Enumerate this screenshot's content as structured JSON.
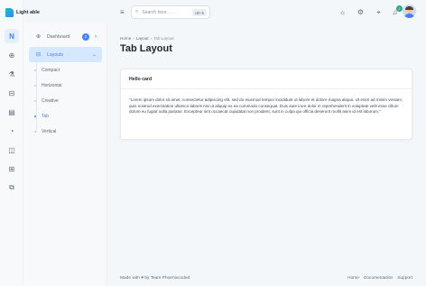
{
  "brand": {
    "name": "Light able"
  },
  "rail": {
    "items": [
      {
        "icon": "N",
        "name": "rail-item-home",
        "active": true
      },
      {
        "icon": "⊕",
        "name": "rail-item-dashboard"
      },
      {
        "icon": "⚗",
        "name": "rail-item-widgets"
      },
      {
        "icon": "⊟",
        "name": "rail-item-layouts"
      },
      {
        "icon": "▤",
        "name": "rail-item-components"
      },
      {
        "icon": "◔",
        "name": "rail-item-charts"
      },
      {
        "icon": "◫",
        "name": "rail-item-forms"
      },
      {
        "icon": "⊞",
        "name": "rail-item-tables"
      },
      {
        "icon": "⧉",
        "name": "rail-item-pages"
      }
    ]
  },
  "sidebar": {
    "dashboard": {
      "label": "Dashboard",
      "icon": "⊕",
      "badge": "2",
      "chevron": "›"
    },
    "layouts": {
      "label": "Layouts",
      "icon": "⊟",
      "chevron": "⌄"
    },
    "subitems": [
      {
        "label": "Compact"
      },
      {
        "label": "Horizontal"
      },
      {
        "label": "Creative"
      },
      {
        "label": "Tab",
        "active": true
      },
      {
        "label": "Vertical"
      }
    ]
  },
  "topbar": {
    "menu_icon": "≡",
    "search_placeholder": "Search here . . .",
    "search_icon": "⌕",
    "shortcut": "ctrl+k",
    "icons": {
      "sun": "☼",
      "settings": "⚙",
      "target": "⌖",
      "bell": "♫"
    },
    "notification_count": "2"
  },
  "breadcrumb": {
    "home": "Home",
    "sep": "›",
    "parent": "Layout",
    "current": "Tab Layout"
  },
  "page": {
    "title": "Tab Layout"
  },
  "card": {
    "title": "Hello card",
    "body": "\"Lorem ipsum dolor sit amet, consectetur adipiscing elit, sed do eiusmod tempor incididunt ut labore et dolore magna aliqua. Ut enim ad minim veniam, quis nostrud exercitation ullamco laboris nisi ut aliquip ex ea commodo consequat. Duis aute irure dolor in reprehenderit in voluptate velit esse cillum dolore eu fugiat nulla pariatur. Excepteur sint occaecat cupidatat non proident, sunt in culpa qui officia deserunt mollit anim id est laborum.\""
  },
  "footer": {
    "left": "Made with ♥ by Team Phoenixcoded",
    "links": [
      "Home",
      "Documentation",
      "Support"
    ]
  },
  "colors": {
    "primary": "#4680ff",
    "success": "#2ca87f",
    "background": "#f4f7fa"
  }
}
